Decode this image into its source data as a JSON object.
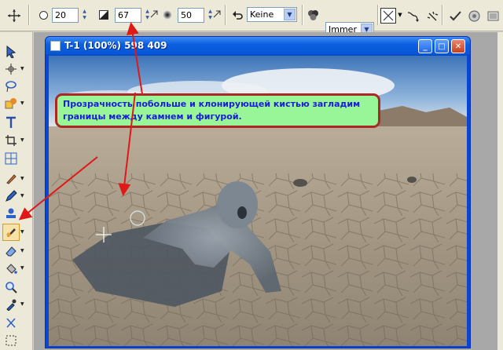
{
  "toolbar": {
    "size_value": "20",
    "opacity_value": "67",
    "hardness_value": "50",
    "mode_value": "Keine",
    "sample_value": "Immer"
  },
  "window": {
    "title": "T-1 (100%) 598 409",
    "minimize_glyph": "_",
    "maximize_glyph": "□",
    "close_glyph": "✕"
  },
  "callout": {
    "text": "Прозрачность побольше и клонирующей кистью загладим границы между камнем и фигурой."
  },
  "colors": {
    "callout_bg": "#98f598",
    "callout_border": "#a92a22",
    "callout_text": "#1b1bd6",
    "arrow": "#e01818",
    "titlebar": "#0b5fe0"
  },
  "icons": {
    "move": "move-icon",
    "brush_shape": "brush-shape-icon",
    "opacity": "opacity-icon",
    "hardness": "hardness-icon",
    "undo": "undo-icon",
    "color_mix": "color-mix-icon",
    "clone_brush": "clone-brush-icon"
  }
}
